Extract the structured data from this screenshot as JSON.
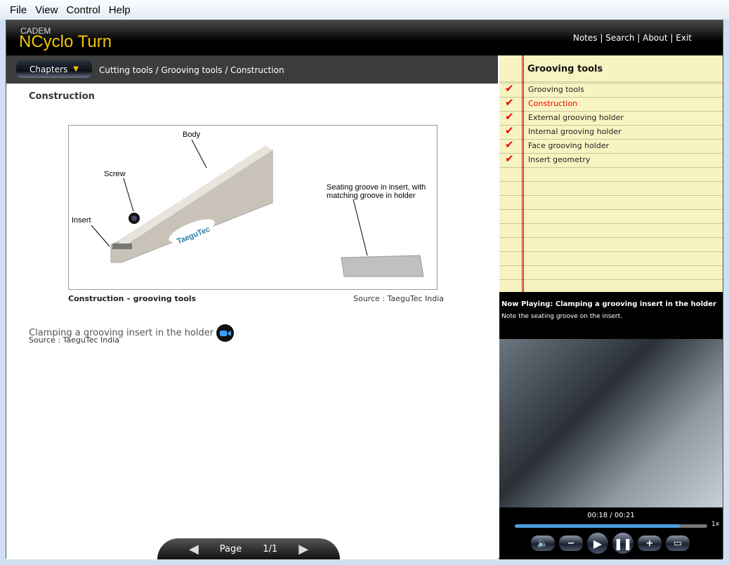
{
  "menu": [
    "File",
    "View",
    "Control",
    "Help"
  ],
  "header": {
    "company": "CADEM",
    "product": "NCyclo Turn",
    "links": [
      "Notes",
      "Search",
      "About",
      "Exit"
    ]
  },
  "breadcrumb": {
    "chapters_label": "Chapters",
    "path": "Cutting tools / Grooving tools / Construction"
  },
  "main": {
    "title": "Construction",
    "figure": {
      "labels": {
        "body": "Body",
        "screw": "Screw",
        "insert": "Insert",
        "groove": "Seating groove in insert, with matching groove in holder",
        "logo": "TaeguTec"
      },
      "caption": "Construction – grooving tools",
      "source": "Source : TaeguTec India"
    },
    "video_link": "Clamping a grooving insert in the holder",
    "video_source": "Source : TaeguTec India",
    "pager": {
      "label": "Page",
      "value": "1/1"
    }
  },
  "notes": {
    "title": "Grooving tools",
    "items": [
      {
        "label": "Grooving tools",
        "done": true,
        "active": false
      },
      {
        "label": "Construction",
        "done": true,
        "active": true
      },
      {
        "label": "External grooving holder",
        "done": true,
        "active": false
      },
      {
        "label": "Internal grooving holder",
        "done": true,
        "active": false
      },
      {
        "label": "Face grooving holder",
        "done": true,
        "active": false
      },
      {
        "label": "Insert geometry",
        "done": true,
        "active": false
      }
    ]
  },
  "player": {
    "now_playing_label": "Now Playing:",
    "now_playing": "Clamping a grooving insert in the holder",
    "description": "Note the seating groove on the insert.",
    "current": "00:18",
    "total": "00:21",
    "progress": 0.857,
    "speed": "1x",
    "buttons": [
      "volume",
      "zoom-out",
      "play",
      "pause",
      "zoom-in",
      "fullscreen"
    ]
  },
  "colors": {
    "accent": "#f2c400",
    "active_item": "#ee0000",
    "progress": "#4aa0e0"
  }
}
